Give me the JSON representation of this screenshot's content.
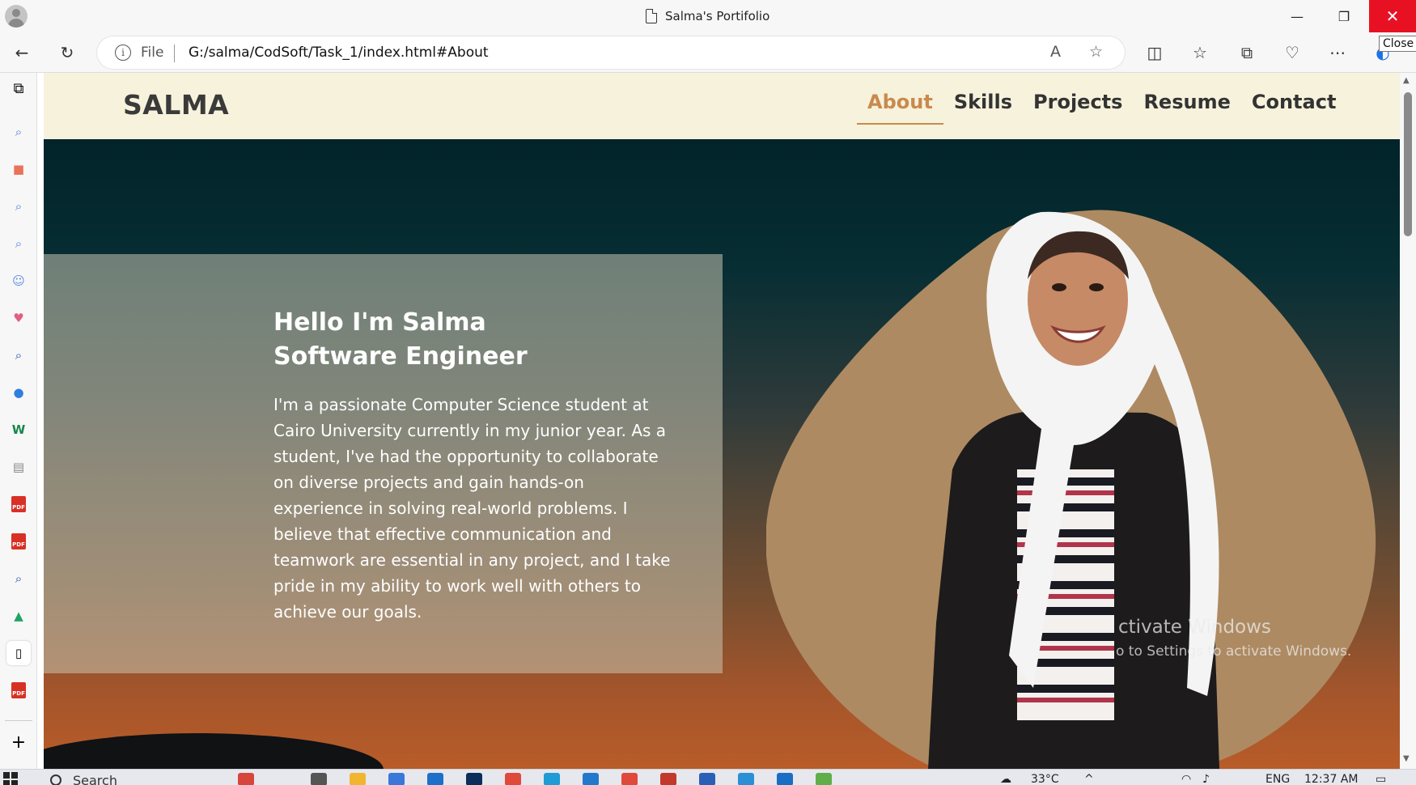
{
  "browser": {
    "tab_title": "Salma's Portifolio",
    "close_tooltip": "Close",
    "omnibox": {
      "file_label": "File",
      "url": "G:/salma/CodSoft/Task_1/index.html#About"
    }
  },
  "site": {
    "logo": "SALMA",
    "nav": [
      {
        "label": "About",
        "active": true
      },
      {
        "label": "Skills",
        "active": false
      },
      {
        "label": "Projects",
        "active": false
      },
      {
        "label": "Resume",
        "active": false
      },
      {
        "label": "Contact",
        "active": false
      }
    ],
    "hero": {
      "headline_line1": "Hello I'm Salma",
      "headline_line2": "Software Engineer",
      "bio": "I'm a passionate Computer Science student at Cairo University currently in my junior year. As a student, I've had the opportunity to collaborate on diverse projects and gain hands-on experience in solving real-world problems. I believe that effective communication and teamwork are essential in any project, and I take pride in my ability to work well with others to achieve our goals."
    },
    "watermark": {
      "line1": "ctivate Windows",
      "line2": "o to Settings to activate Windows."
    }
  },
  "taskbar": {
    "search_label": "Search",
    "temperature": "33°C",
    "language": "ENG",
    "time": "12:37 AM"
  },
  "colors": {
    "nav_background": "#f6f2dc",
    "accent": "#c98a4e",
    "blob": "#ae8a62",
    "close_button": "#e81123"
  }
}
